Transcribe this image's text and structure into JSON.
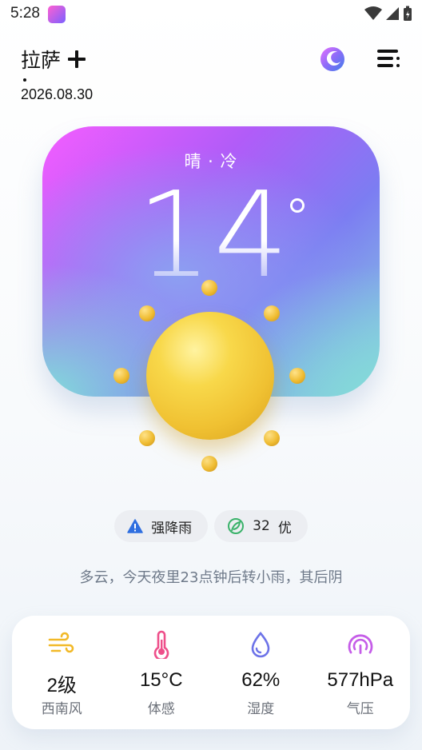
{
  "status_bar": {
    "time": "5:28"
  },
  "header": {
    "city": "拉萨",
    "date": "2026.08.30"
  },
  "weather": {
    "condition": "晴 · 冷",
    "temperature": "14"
  },
  "badges": {
    "alert": {
      "label": "强降雨",
      "icon": "warning-triangle-icon",
      "color": "#2f6fe0"
    },
    "aqi": {
      "value": "32",
      "level": "优",
      "icon": "leaf-icon",
      "color": "#3ab26a"
    }
  },
  "summary": "多云，今天夜里23点钟后转小雨，其后阴",
  "stats": [
    {
      "value": "2级",
      "label": "西南风",
      "icon": "wind-icon",
      "color": "#f2b928"
    },
    {
      "value": "15°C",
      "label": "体感",
      "icon": "thermometer-icon",
      "color": "#ee4f8a"
    },
    {
      "value": "62%",
      "label": "湿度",
      "icon": "humidity-drop-icon",
      "color": "#6d73e8"
    },
    {
      "value": "577hPa",
      "label": "气压",
      "icon": "pressure-gauge-icon",
      "color": "#c55de8"
    }
  ]
}
